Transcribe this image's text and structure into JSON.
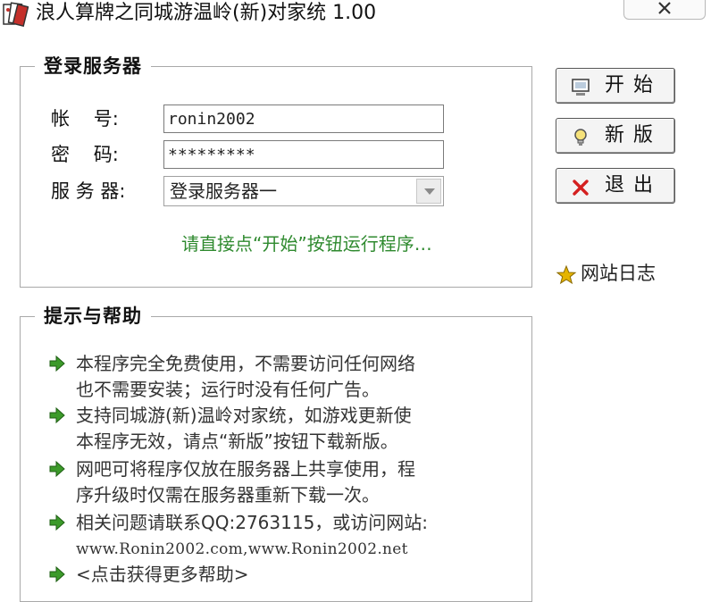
{
  "window": {
    "title": "浪人算牌之同城游温岭(新)对家统 1.00"
  },
  "login_group": {
    "legend": "登录服务器",
    "account_label": "帐    号:",
    "account_value": "ronin2002",
    "password_label": "密    码:",
    "password_value": "*********",
    "server_label": "服 务 器:",
    "server_selected": "登录服务器一",
    "hint": "请直接点“开始”按钮运行程序…"
  },
  "buttons": {
    "start": "开始",
    "update": "新版",
    "exit": "退出"
  },
  "site_log": "网站日志",
  "help_group": {
    "legend": "提示与帮助",
    "items": [
      {
        "lines": [
          "本程序完全免费使用，不需要访问任何网络",
          "也不需要安装；运行时没有任何广告。"
        ]
      },
      {
        "lines": [
          "支持同城游(新)温岭对家统，如游戏更新使",
          "本程序无效，请点“新版”按钮下载新版。"
        ]
      },
      {
        "lines": [
          "网吧可将程序仅放在服务器上共享使用，程",
          "序升级时仅需在服务器重新下载一次。"
        ]
      },
      {
        "lines": [
          "相关问题请联系QQ:2763115，或访问网站:",
          "www.Ronin2002.com,www.Ronin2002.net"
        ]
      },
      {
        "lines": [
          "<点击获得更多帮助>"
        ]
      }
    ]
  },
  "colors": {
    "hint_green": "#2f8a2f",
    "bullet_green": "#3c9a2a",
    "exit_red": "#d42020",
    "star_gold": "#e5b400"
  },
  "icons": {
    "app": "playing-cards-icon",
    "close": "close-icon",
    "start": "monitor-icon",
    "update": "lightbulb-icon",
    "exit": "x-icon",
    "site_log": "star-icon",
    "bullet": "arrow-right-icon"
  }
}
